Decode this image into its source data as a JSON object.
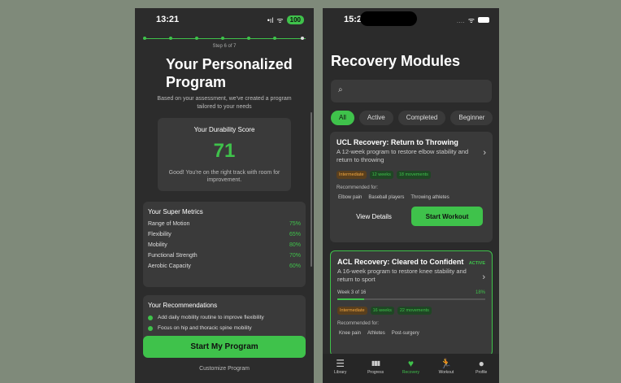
{
  "left": {
    "status": {
      "time": "13:21",
      "signal": "•ıl",
      "battery": "100"
    },
    "step_label": "Step 6 of 7",
    "title": "Your Personalized Program",
    "subtitle": "Based on your assessment, we've created a program tailored to your needs",
    "score": {
      "heading": "Your Durability Score",
      "value": "71",
      "description": "Good! You're on the right track with room for improvement."
    },
    "metrics": {
      "heading": "Your Super Metrics",
      "items": [
        {
          "label": "Range of Motion",
          "value": "75%"
        },
        {
          "label": "Flexibility",
          "value": "65%"
        },
        {
          "label": "Mobility",
          "value": "80%"
        },
        {
          "label": "Functional Strength",
          "value": "70%"
        },
        {
          "label": "Aerobic Capacity",
          "value": "60%"
        }
      ]
    },
    "recommendations": {
      "heading": "Your Recommendations",
      "items": [
        "Add daily mobility routine to improve flexibility",
        "Focus on hip and thoracic spine mobility"
      ]
    },
    "start_button": "Start My Program",
    "customize_link": "Customize Program"
  },
  "right": {
    "status": {
      "time": "15:29",
      "dots": "....",
      "wifi": "ᯤ"
    },
    "title": "Recovery Modules",
    "search": {
      "placeholder": ""
    },
    "filters": [
      "All",
      "Active",
      "Completed",
      "Beginner"
    ],
    "modules": [
      {
        "title": "UCL Recovery: Return to Throwing",
        "description": "A 12-week program to restore elbow stability and return to throwing",
        "level": "Intermediate",
        "weeks": "12 weeks",
        "movements": "18 movements",
        "recommended_label": "Recommended for:",
        "recommended": [
          "Elbow pain",
          "Baseball players",
          "Throwing athletes"
        ],
        "view_label": "View Details",
        "start_label": "Start Workout"
      },
      {
        "title": "ACL Recovery: Cleared to Confident",
        "description": "A 16-week program to restore knee stability and return to sport",
        "badge": "ACTIVE",
        "week_label": "Week 3 of 16",
        "progress": "18%",
        "progress_value": 18,
        "level": "Intermediate",
        "weeks": "16 weeks",
        "movements": "22 movements",
        "recommended_label": "Recommended for:",
        "recommended": [
          "Knee pain",
          "Athletes",
          "Post-surgery"
        ]
      }
    ],
    "tabs": [
      {
        "label": "Library",
        "icon": "☰"
      },
      {
        "label": "Progress",
        "icon": "▮▮▮"
      },
      {
        "label": "Recovery",
        "icon": "♥"
      },
      {
        "label": "Workout",
        "icon": "🏃"
      },
      {
        "label": "Profile",
        "icon": "●"
      }
    ]
  },
  "colors": {
    "accent": "#3fc24b",
    "background": "#2c2c2c",
    "card": "#3a3a3a",
    "level": "#f0a640"
  }
}
